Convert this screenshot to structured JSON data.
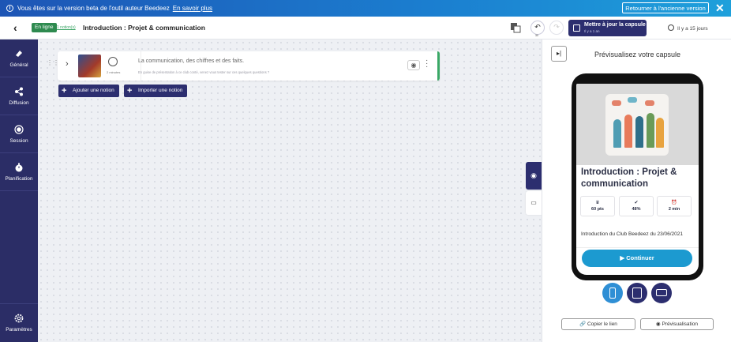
{
  "banner": {
    "message": "Vous êtes sur la version beta de l'outil auteur Beedeez",
    "link": "En savoir plus",
    "back_button": "Retourner à l'ancienne version",
    "close_icon": "close-icon",
    "colors": {
      "start": "#1d55b5",
      "end": "#1ea0db"
    }
  },
  "header": {
    "status": "En ligne",
    "notions_count": "1 notion(s)",
    "title": "Introduction : Projet & communication",
    "undo_count": "30",
    "update_button": "Mettre à jour la capsule",
    "update_sub": "Il y a 1 an",
    "history": "Il y a 15 jours"
  },
  "sidebar": {
    "items": [
      {
        "label": "Général",
        "icon": "eraser-icon"
      },
      {
        "label": "Diffusion",
        "icon": "share-icon"
      },
      {
        "label": "Session",
        "icon": "record-icon"
      },
      {
        "label": "Planification",
        "icon": "stopwatch-icon"
      }
    ],
    "settings": {
      "label": "Paramètres",
      "icon": "gear-icon"
    },
    "color": "#2b2d66"
  },
  "editor": {
    "notion": {
      "title": "La communication, des chiffres et des faits.",
      "description": "En guise de présentation à ce club conté, venez vous tester sur ces quelques questions ?",
      "duration": "2 minutes"
    },
    "add_notion": "Ajouter une notion",
    "import_notion": "Importer une notion"
  },
  "preview": {
    "title": "Prévisualisez votre capsule",
    "capsule_title": "Introduction : Projet & communication",
    "stats": [
      {
        "icon": "trophy-icon",
        "value": "60 pts"
      },
      {
        "icon": "check-badge-icon",
        "value": "48%"
      },
      {
        "icon": "alarm-icon",
        "value": "2 min"
      }
    ],
    "intro": "Introduction du Club Beedeez du 23/06/2021",
    "continue_button": "Continuer",
    "devices": [
      "mobile-icon",
      "tablet-icon",
      "laptop-icon"
    ],
    "copy_link": "Copier le lien",
    "preview_button": "Prévisualisation",
    "accent": "#1c9ad0"
  }
}
